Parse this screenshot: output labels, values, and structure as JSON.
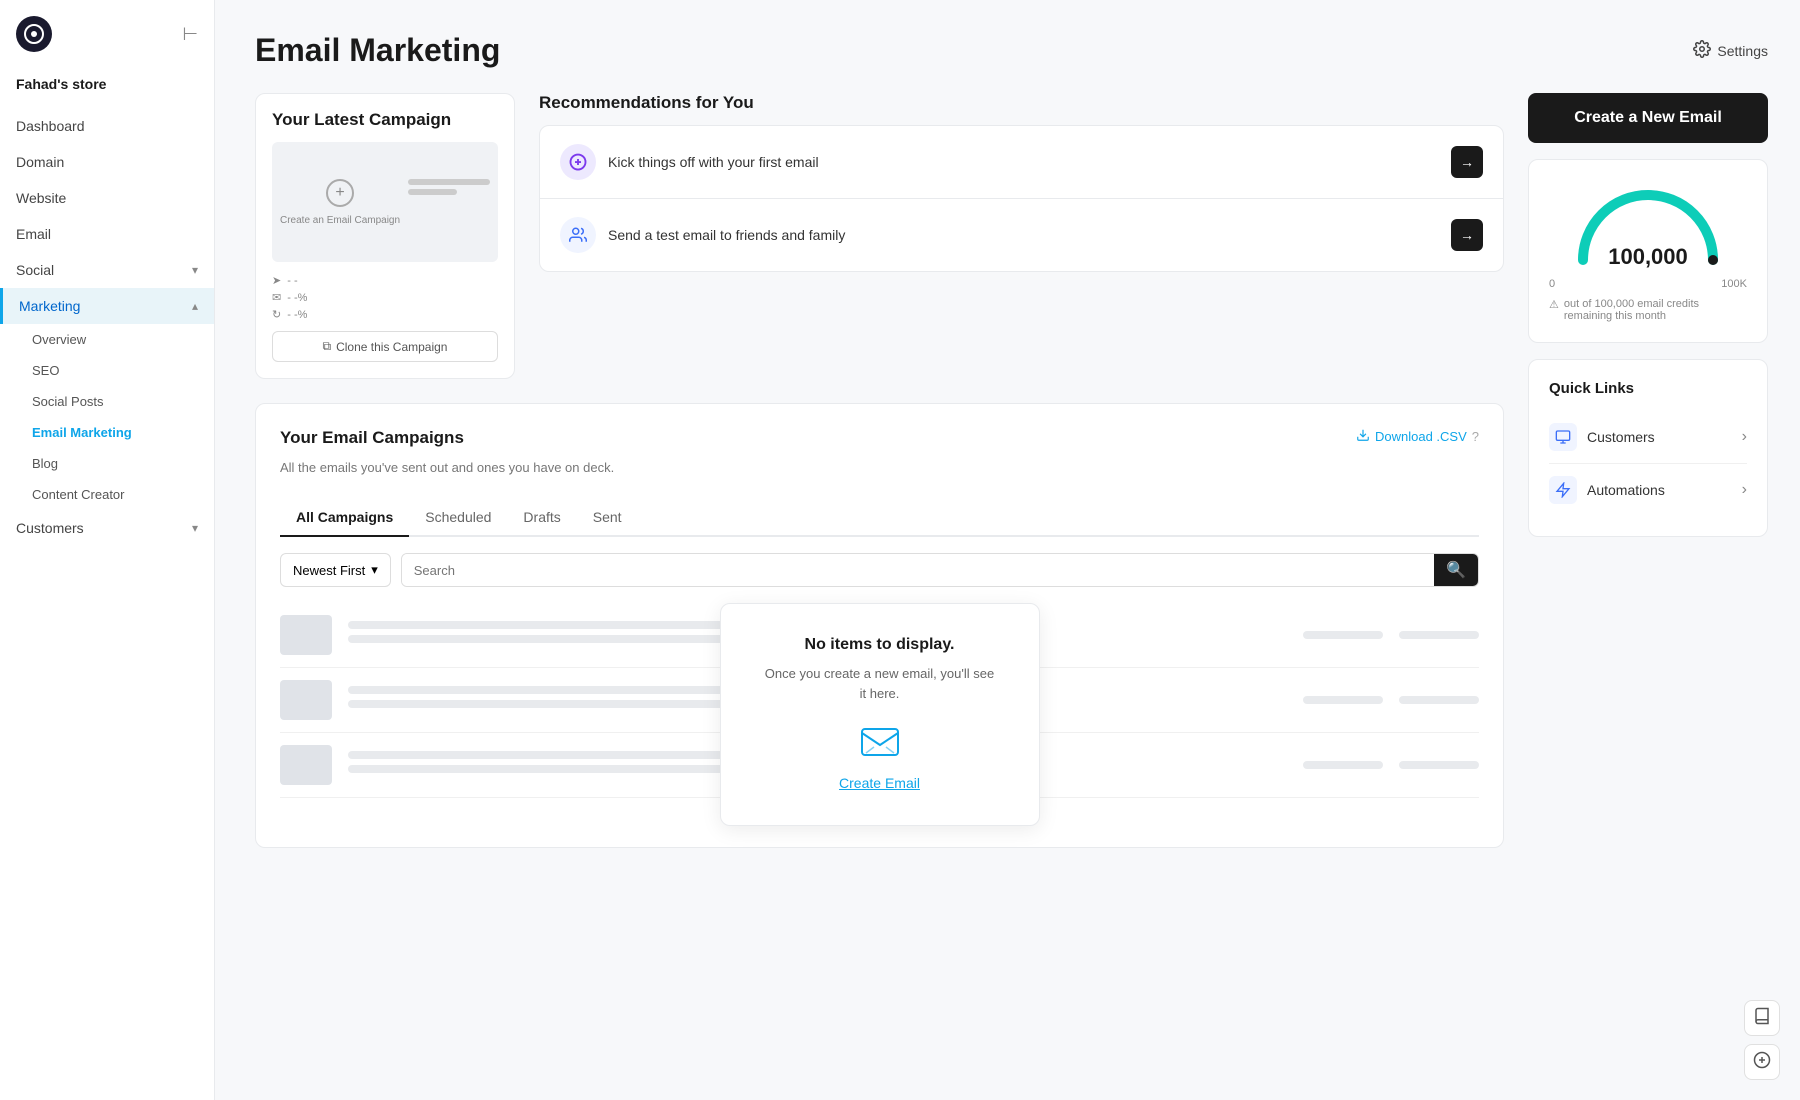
{
  "app": {
    "logo_char": "⊙",
    "store_name": "Fahad's store"
  },
  "sidebar": {
    "nav_items": [
      {
        "id": "dashboard",
        "label": "Dashboard",
        "has_children": false
      },
      {
        "id": "domain",
        "label": "Domain",
        "has_children": false
      },
      {
        "id": "website",
        "label": "Website",
        "has_children": false
      },
      {
        "id": "email",
        "label": "Email",
        "has_children": false
      },
      {
        "id": "social",
        "label": "Social",
        "has_children": true
      },
      {
        "id": "marketing",
        "label": "Marketing",
        "has_children": true
      }
    ],
    "marketing_subitems": [
      {
        "id": "overview",
        "label": "Overview"
      },
      {
        "id": "seo",
        "label": "SEO"
      },
      {
        "id": "social-posts",
        "label": "Social Posts"
      },
      {
        "id": "email-marketing",
        "label": "Email Marketing",
        "active": true
      },
      {
        "id": "blog",
        "label": "Blog"
      },
      {
        "id": "content-creator",
        "label": "Content Creator"
      }
    ],
    "customers_label": "Customers"
  },
  "header": {
    "title": "Email Marketing",
    "settings_label": "Settings"
  },
  "latest_campaign": {
    "section_title": "Your Latest Campaign",
    "create_label": "Create an Email Campaign",
    "clone_btn": "Clone this Campaign",
    "stats": [
      {
        "icon": "→",
        "value": "- -"
      },
      {
        "icon": "✉",
        "value": "- -%"
      },
      {
        "icon": "↻",
        "value": "- -%"
      }
    ]
  },
  "recommendations": {
    "section_title": "Recommendations for You",
    "items": [
      {
        "id": "first-email",
        "text": "Kick things off with your first email"
      },
      {
        "id": "test-email",
        "text": "Send a test email to friends and family"
      }
    ]
  },
  "campaigns": {
    "section_title": "Your Email Campaigns",
    "description": "All the emails you've sent out and ones you have on deck.",
    "download_csv": "Download .CSV",
    "tabs": [
      {
        "id": "all",
        "label": "All Campaigns",
        "active": true
      },
      {
        "id": "scheduled",
        "label": "Scheduled"
      },
      {
        "id": "drafts",
        "label": "Drafts"
      },
      {
        "id": "sent",
        "label": "Sent"
      }
    ],
    "sort_label": "Newest First",
    "search_placeholder": "Search",
    "empty_title": "No items to display.",
    "empty_desc": "Once you create a new email, you'll see it here.",
    "create_email_link": "Create Email"
  },
  "right_sidebar": {
    "create_btn": "Create a New Email",
    "gauge": {
      "value": "100,000",
      "min_label": "0",
      "max_label": "100K",
      "warning_text": "out of 100,000 email credits remaining this month",
      "percent": 100
    },
    "quick_links": {
      "title": "Quick Links",
      "items": [
        {
          "id": "customers",
          "label": "Customers",
          "icon": "👥"
        },
        {
          "id": "automations",
          "label": "Automations",
          "icon": "⚡"
        }
      ]
    }
  },
  "bottom_icons": [
    {
      "id": "book-icon",
      "char": "📖"
    },
    {
      "id": "sparkle-icon",
      "char": "✨"
    }
  ]
}
